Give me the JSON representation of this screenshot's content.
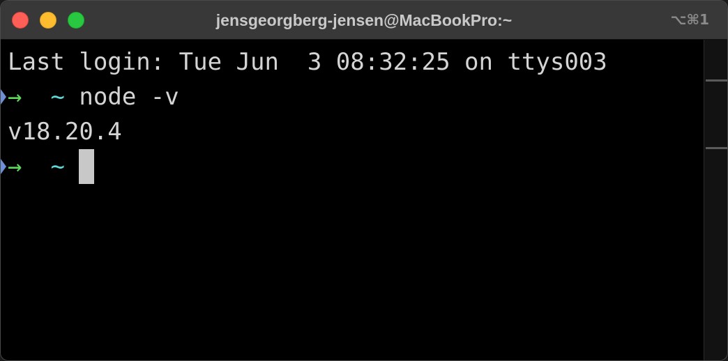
{
  "window": {
    "title": "jensgeorgberg-jensen@MacBookPro:~",
    "shortcut": "⌥⌘1"
  },
  "terminal": {
    "lines": [
      {
        "text": "Last login: Tue Jun  3 08:32:25 on ttys003"
      },
      {
        "prompt_arrow": "→",
        "prompt_dir": "~",
        "command": "node -v"
      },
      {
        "text": "v18.20.4"
      },
      {
        "prompt_arrow": "→",
        "prompt_dir": "~",
        "command": ""
      }
    ]
  },
  "icons": {
    "close": "close-icon",
    "minimize": "minimize-icon",
    "maximize": "maximize-icon",
    "prompt": "arrow-right-icon",
    "cursor": "block-cursor"
  },
  "colors": {
    "background": "#000000",
    "text": "#d4d4d4",
    "prompt_arrow": "#5fd75f",
    "prompt_dir": "#5fd7d7",
    "mark": "#6e8fd6",
    "titlebar": "#383838",
    "close": "#ff5f57",
    "minimize": "#febc2e",
    "maximize": "#28c840"
  }
}
